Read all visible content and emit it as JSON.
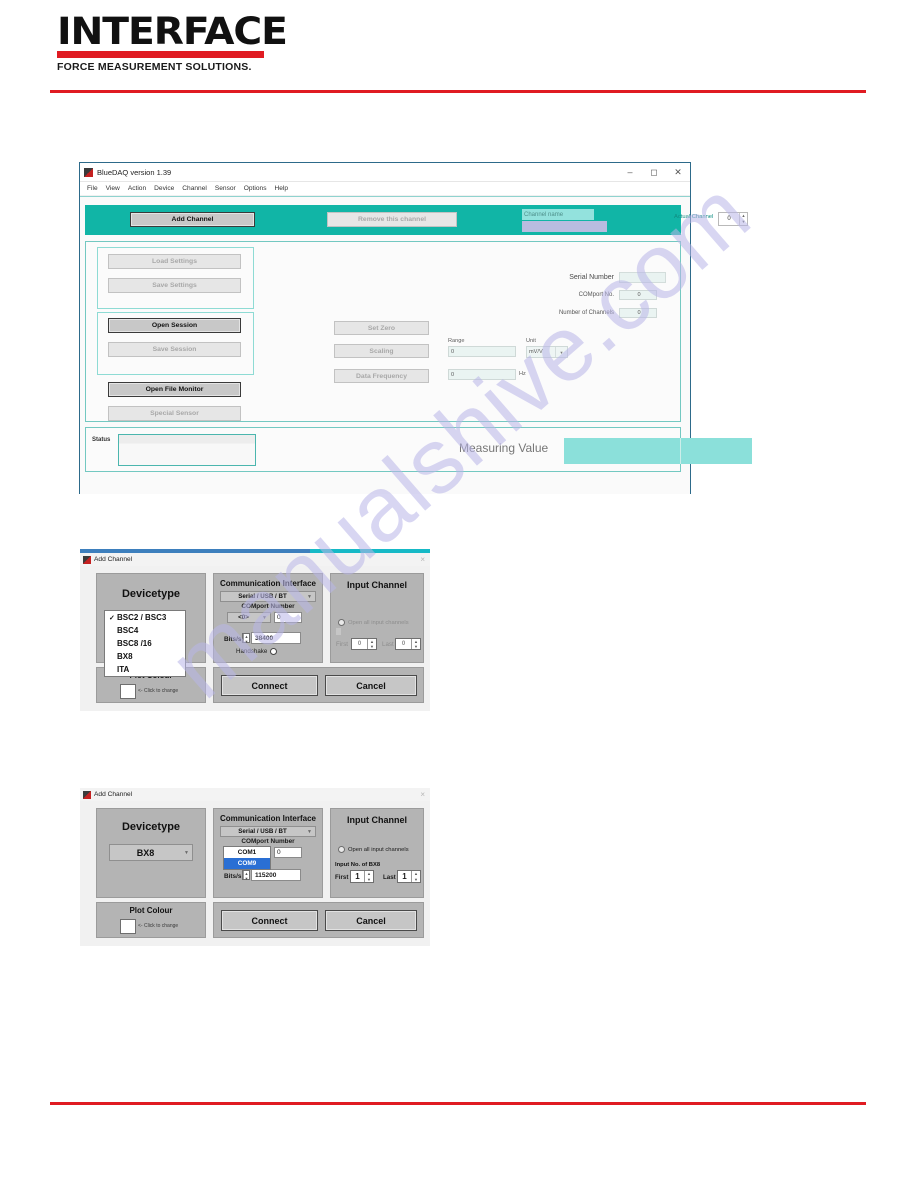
{
  "header": {
    "logo_word": "INTERFACE",
    "logo_tagline": "FORCE MEASUREMENT SOLUTIONS."
  },
  "watermark": {
    "text": "manualshive.com"
  },
  "main_window": {
    "title": "BlueDAQ version 1.39",
    "window_controls": {
      "minimize": "–",
      "maximize": "❐",
      "close": "✕"
    },
    "menu": [
      "File",
      "View",
      "Action",
      "Device",
      "Channel",
      "Sensor",
      "Options",
      "Help"
    ],
    "toolbar": {
      "add_channel": "Add Channel",
      "remove_channel": "Remove this channel",
      "channel_name_label": "Channel name",
      "channel_name_value": "",
      "actual_channel_label": "Actual Channel",
      "actual_channel_value": "0"
    },
    "left_buttons": {
      "load_settings": "Load Settings",
      "save_settings": "Save Settings",
      "open_session": "Open Session",
      "save_session": "Save Session",
      "open_file_monitor": "Open File Monitor",
      "special_sensor": "Special Sensor"
    },
    "center_buttons": {
      "set_zero": "Set Zero",
      "scaling": "Scaling",
      "data_frequency": "Data Frequency"
    },
    "fields": {
      "range_label": "Range",
      "range_value": "0",
      "unit_label": "Unit",
      "unit_value": "mV/V",
      "data_frequency_value": "0",
      "hz_label": "Hz",
      "serial_number_label": "Serial Number",
      "serial_number_value": "",
      "comport_label": "COMport No.",
      "comport_value": "0",
      "number_of_channels_label": "Number of Channels",
      "number_of_channels_value": "0"
    },
    "status": {
      "status_label": "Status",
      "status_value": "",
      "measuring_value_label": "Measuring Value",
      "measuring_value": ""
    }
  },
  "dialog1": {
    "title": "Add Channel",
    "close": "×",
    "devicetype": {
      "title": "Devicetype",
      "options": [
        "BSC2 / BSC3",
        "BSC4",
        "BSC8 /16",
        "BX8",
        "ITA"
      ],
      "selected": "BSC2 / BSC3",
      "check_glyph": "✓"
    },
    "comm": {
      "title": "Communication Interface",
      "interface_value": "Serial / USB / BT",
      "comport_label": "COMport Number",
      "comport_combo": "<0>",
      "comport_value": "0",
      "bits_label": "Bits/s",
      "bits_value": "38400",
      "handshake_label": "Handshake"
    },
    "input": {
      "title": "Input Channel",
      "open_all_label": "Open all input channels",
      "first_label": "First",
      "first_value": "0",
      "last_label": "Last",
      "last_value": "0"
    },
    "plot": {
      "title": "Plot Colour",
      "hint": "<- Click to change",
      "colour": "#ffffff"
    },
    "connect": "Connect",
    "cancel": "Cancel"
  },
  "dialog2": {
    "title": "Add Channel",
    "close": "×",
    "devicetype": {
      "title": "Devicetype",
      "selected": "BX8"
    },
    "comm": {
      "title": "Communication Interface",
      "interface_value": "Serial / USB / BT",
      "comport_label": "COMport Number",
      "comport_list": [
        "COM1",
        "COM9"
      ],
      "comport_selected": "COM9",
      "comport_value": "0",
      "bits_label": "Bits/s",
      "bits_value": "115200"
    },
    "input": {
      "title": "Input Channel",
      "open_all_label": "Open all input channels",
      "input_no_label": "Input No. of BX8",
      "first_label": "First",
      "first_value": "1",
      "last_label": "Last",
      "last_value": "1"
    },
    "plot": {
      "title": "Plot Colour",
      "hint": "<- Click to change",
      "colour": "#ffffff"
    },
    "connect": "Connect",
    "cancel": "Cancel"
  },
  "colors": {
    "brand_red": "#e01b22",
    "teal": "#11b5a6",
    "measure_teal": "#8be0da",
    "select_blue": "#2a6fd4"
  }
}
